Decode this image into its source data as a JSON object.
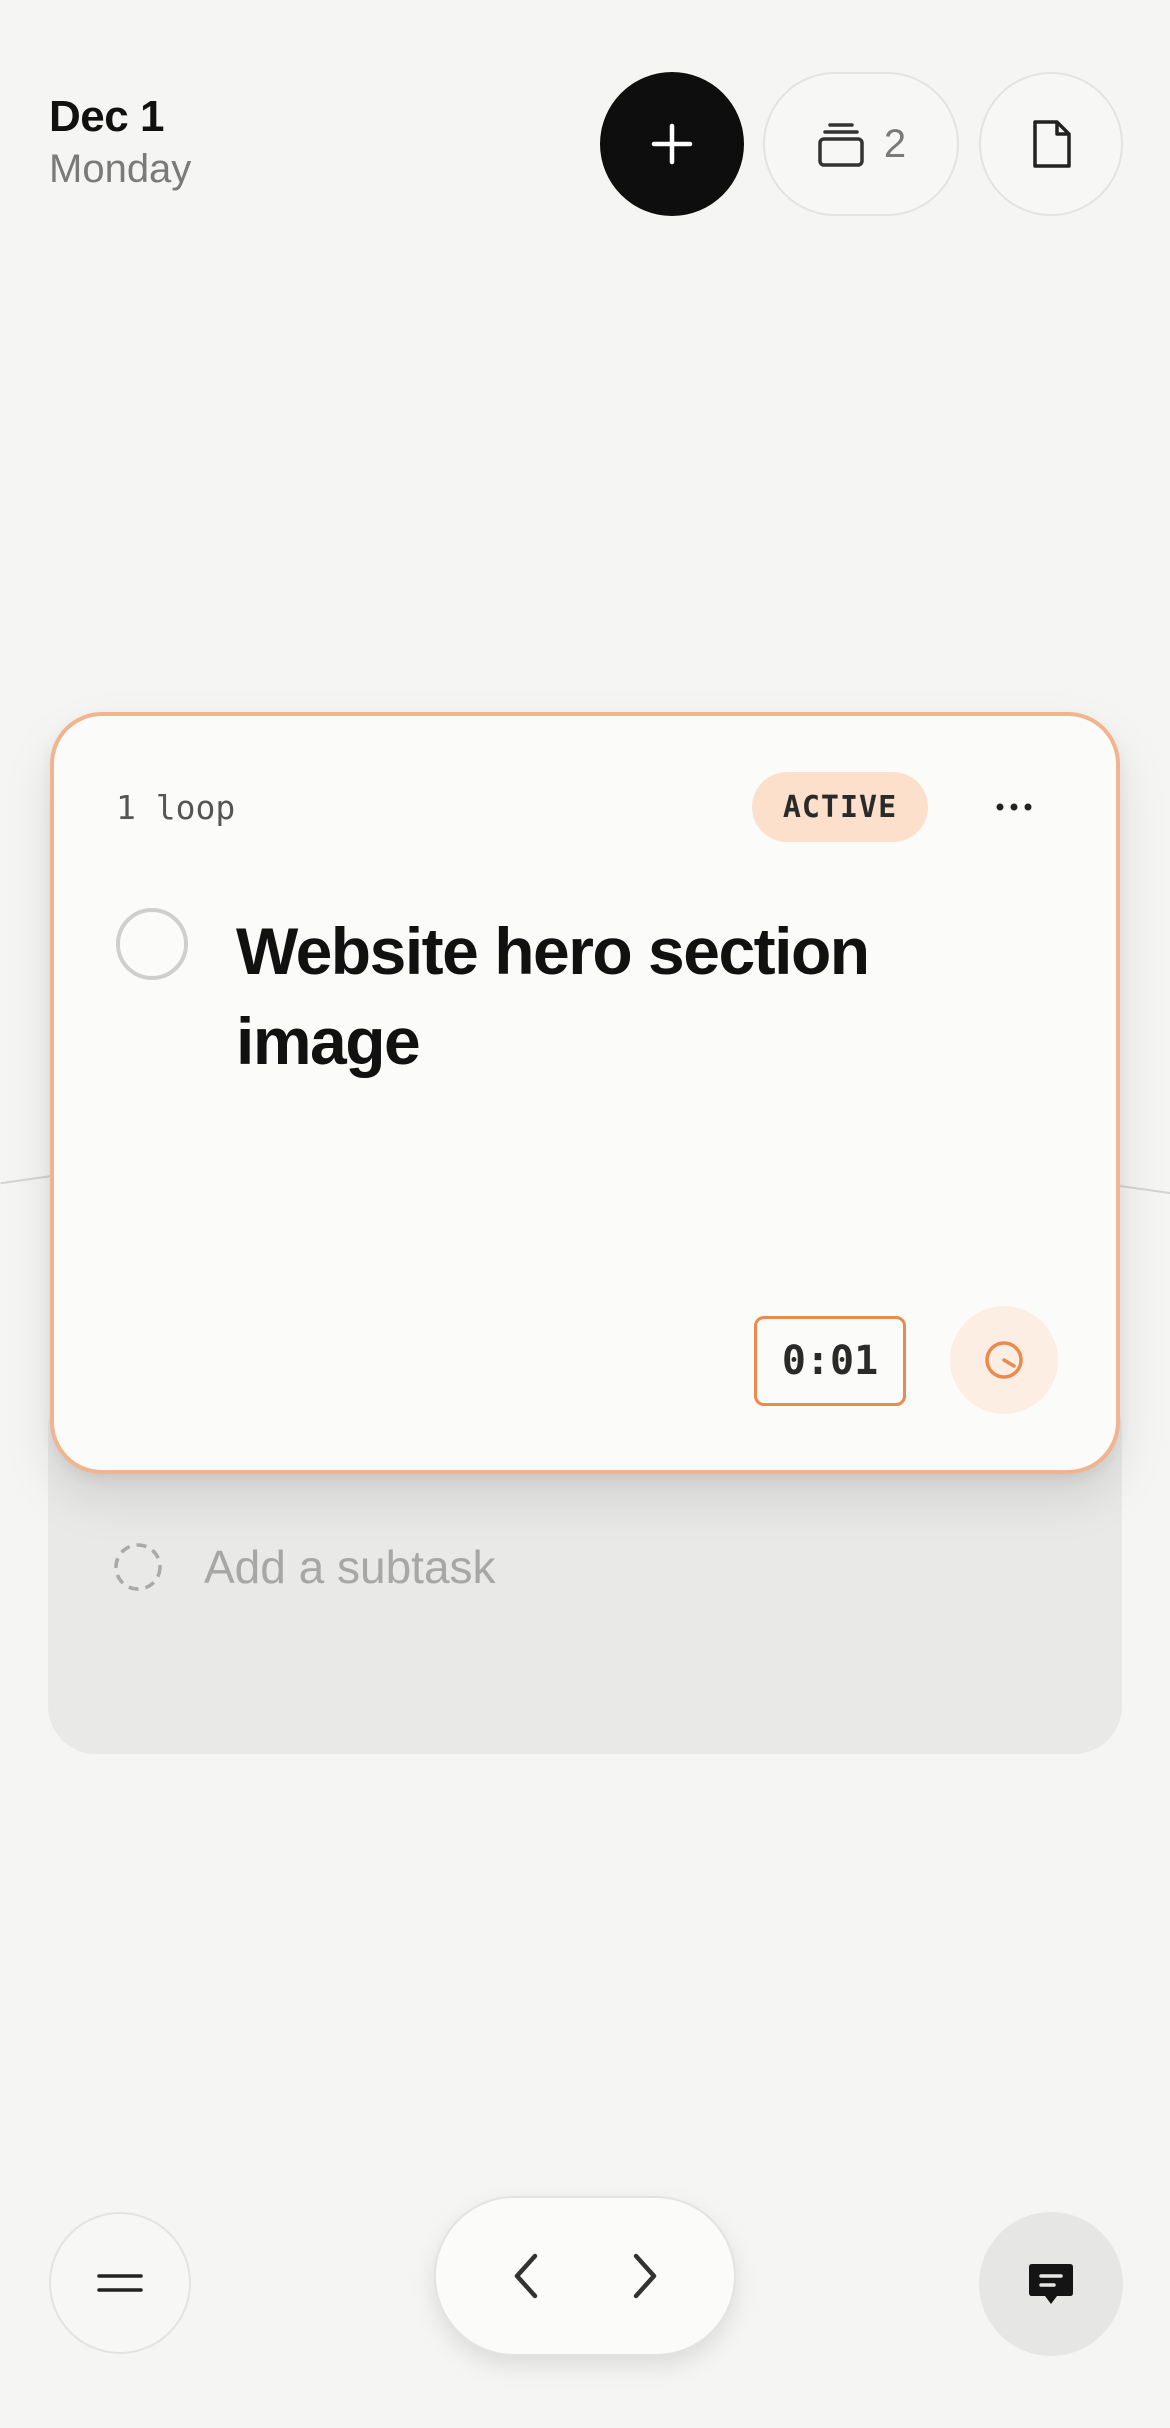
{
  "header": {
    "date": "Dec 1",
    "weekday": "Monday",
    "stack_count": "2",
    "icons": [
      "plus-icon",
      "stack-icon",
      "document-icon"
    ]
  },
  "task_card": {
    "loop_label": "1 loop",
    "status": "ACTIVE",
    "title": "Website hero section image",
    "timer": "0:01",
    "colors": {
      "accent": "#ec8a4e",
      "badge_bg": "#fde0cc",
      "border": "#f1b48e"
    }
  },
  "subtask": {
    "placeholder": "Add a subtask"
  },
  "bottom_bar": {
    "icons": [
      "menu-icon",
      "chevron-left-icon",
      "chevron-right-icon",
      "chat-icon"
    ]
  }
}
